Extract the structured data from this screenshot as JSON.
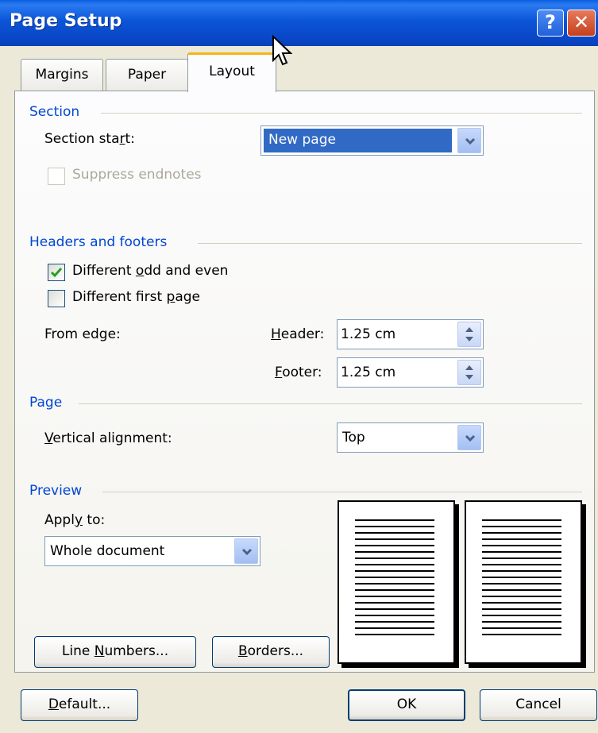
{
  "window": {
    "title": "Page Setup",
    "help_glyph": "?",
    "close_glyph": "✕"
  },
  "tabs": [
    {
      "label": "Margins",
      "selected": false
    },
    {
      "label": "Paper",
      "selected": false
    },
    {
      "label": "Layout",
      "selected": true
    }
  ],
  "section": {
    "heading": "Section",
    "start_label_pre": "Section sta",
    "start_label_ul": "r",
    "start_label_post": "t:",
    "start_value": "New page",
    "suppress_endnotes": "Suppress endnotes"
  },
  "headers_footers": {
    "heading": "Headers and footers",
    "odd_even_pre": "Different ",
    "odd_even_ul": "o",
    "odd_even_post": "dd and even",
    "odd_even_checked": true,
    "first_page_pre": "Different first ",
    "first_page_ul": "p",
    "first_page_post": "age",
    "first_page_checked": false,
    "from_edge": "From edge:",
    "header_ul": "H",
    "header_post": "eader:",
    "header_value": "1.25 cm",
    "footer_ul": "F",
    "footer_post": "ooter:",
    "footer_value": "1.25 cm"
  },
  "page": {
    "heading": "Page",
    "valign_ul": "V",
    "valign_post": "ertical alignment:",
    "valign_value": "Top"
  },
  "preview": {
    "heading": "Preview",
    "apply_to_pre": "Appl",
    "apply_to_ul": "y",
    "apply_to_post": " to:",
    "apply_to_value": "Whole document"
  },
  "buttons": {
    "line_numbers_pre": "Line ",
    "line_numbers_ul": "N",
    "line_numbers_post": "umbers...",
    "borders_ul": "B",
    "borders_post": "orders...",
    "default_ul": "D",
    "default_post": "efault...",
    "ok": "OK",
    "cancel": "Cancel"
  },
  "colors": {
    "accent_blue": "#0046d5",
    "selection": "#316ac5",
    "titlebar": "#0a48c8"
  }
}
